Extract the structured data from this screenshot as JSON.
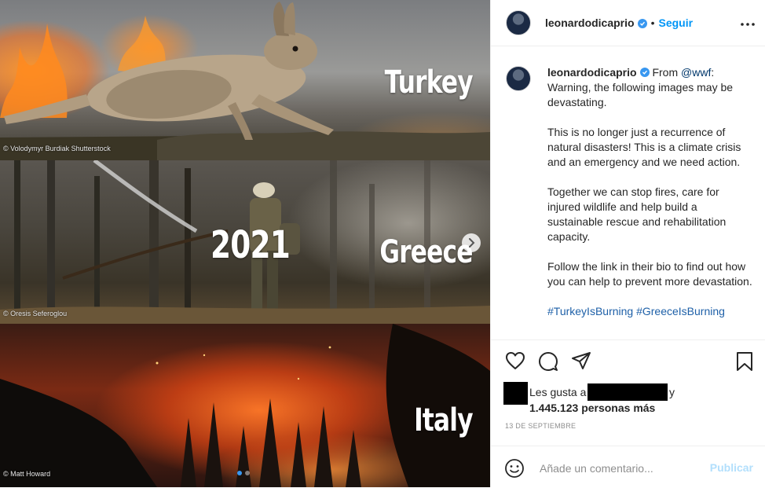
{
  "media": {
    "panels": [
      {
        "place": "Turkey",
        "credit": "© Volodymyr Burdiak Shutterstock"
      },
      {
        "place": "Greece",
        "credit": "© Oresis Seferoglou",
        "year": "2021"
      },
      {
        "place": "Italy",
        "credit": "© Matt Howard"
      }
    ],
    "next_icon": "chevron-right-icon",
    "slide_dots": {
      "count": 2,
      "active_index": 0
    }
  },
  "header": {
    "username": "leonardodicaprio",
    "separator": "•",
    "follow_label": "Seguir",
    "more_icon": "ellipsis-icon"
  },
  "caption": {
    "username": "leonardodicaprio",
    "from_prefix": "From ",
    "mention": "@wwf",
    "from_rest": ": Warning, the following images may be devastating.",
    "paragraph_2": "This is no longer just a recurrence of natural disasters! This is a climate crisis and an emergency and we need action.",
    "paragraph_3": "Together we can stop fires, care for injured wildlife and help build a sustainable rescue and rehabilitation capacity.",
    "paragraph_4": "Follow the link in their bio to find out how you can help to prevent more devastation.",
    "hashtags": "#TurkeyIsBurning #GreeceIsBurning"
  },
  "actions": {
    "like_icon": "heart-icon",
    "comment_icon": "comment-icon",
    "share_icon": "send-icon",
    "save_icon": "bookmark-icon"
  },
  "likes": {
    "prefix": "Les gusta a",
    "suffix_y": "y",
    "count": "1.445.123",
    "others_label": "personas más"
  },
  "date": "13 DE SEPTIEMBRE",
  "comment": {
    "emoji_icon": "smiley-icon",
    "placeholder": "Añade un comentario...",
    "publish_label": "Publicar"
  },
  "colors": {
    "accent": "#0095f6",
    "publish_disabled": "#b2dffc",
    "hashtag": "#1e60a8",
    "muted": "#8e8e8e"
  }
}
